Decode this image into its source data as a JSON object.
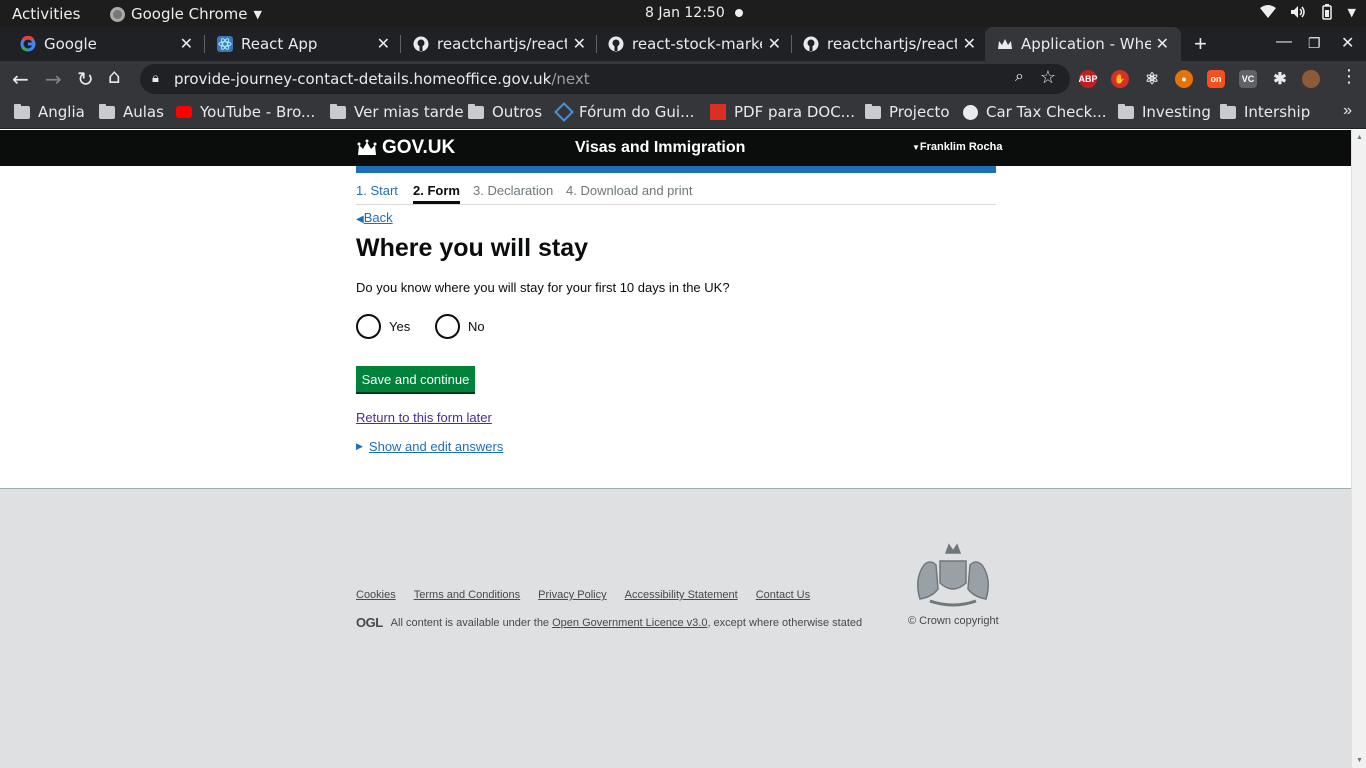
{
  "os": {
    "activities": "Activities",
    "app_menu": "Google Chrome",
    "clock": "8 Jan  12:50"
  },
  "tabs": [
    {
      "title": "Google"
    },
    {
      "title": "React App"
    },
    {
      "title": "reactchartjs/react-c"
    },
    {
      "title": "react-stock-market-"
    },
    {
      "title": "reactchartjs/react-c"
    },
    {
      "title": "Application - Where"
    }
  ],
  "address": {
    "host": "provide-journey-contact-details.homeoffice.gov.uk",
    "path": "/next"
  },
  "bookmarks": [
    {
      "label": "Anglia"
    },
    {
      "label": "Aulas"
    },
    {
      "label": "YouTube - Bro..."
    },
    {
      "label": "Ver mias tarde"
    },
    {
      "label": "Outros"
    },
    {
      "label": "Fórum do Gui..."
    },
    {
      "label": "PDF para DOC..."
    },
    {
      "label": "Projecto"
    },
    {
      "label": "Car Tax Check..."
    },
    {
      "label": "Investing"
    },
    {
      "label": "Intership"
    }
  ],
  "header": {
    "logo": "GOV.UK",
    "service": "Visas and Immigration",
    "user": "Franklim Rocha"
  },
  "steps": [
    "1. Start",
    "2. Form",
    "3. Declaration",
    "4. Download and print"
  ],
  "main": {
    "back": "Back",
    "title": "Where you will stay",
    "question": "Do you know where you will stay for your first 10 days in the UK?",
    "options": [
      "Yes",
      "No"
    ],
    "save_button": "Save and continue",
    "return_link": "Return to this form later",
    "details_toggle": "Show and edit answers"
  },
  "footer": {
    "links": [
      "Cookies",
      "Terms and Conditions",
      "Privacy Policy",
      "Accessibility Statement",
      "Contact Us"
    ],
    "ogl": "OGL",
    "licence_prefix": "All content is available under the",
    "licence_link": "Open Government Licence v3.0",
    "licence_suffix": ", except where otherwise stated",
    "copyright": "© Crown copyright"
  },
  "colors": {
    "gov_black": "#0b0c0c",
    "gov_blue": "#1d70b8",
    "gov_green": "#00823b",
    "visited_purple": "#4c2c92",
    "footer_grey": "#dee0e2"
  }
}
